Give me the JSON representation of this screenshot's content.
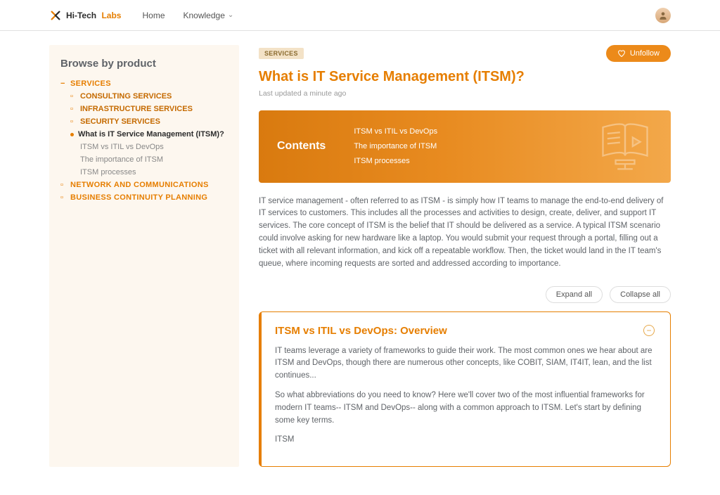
{
  "nav": {
    "brand_dark": "Hi-Tech",
    "brand_orange": "Labs",
    "home": "Home",
    "knowledge": "Knowledge"
  },
  "sidebar": {
    "heading": "Browse by product",
    "root": "SERVICES",
    "subs": {
      "consulting": "CONSULTING SERVICES",
      "infra": "INFRASTRUCTURE SERVICES",
      "security": "SECURITY SERVICES"
    },
    "selected": "What is IT Service Management (ITSM)?",
    "leaves": {
      "l1": "ITSM vs ITIL vs DevOps",
      "l2": "The importance of ITSM",
      "l3": "ITSM processes"
    },
    "cats": {
      "network": "NETWORK AND COMMUNICATIONS",
      "bcp": "BUSINESS CONTINUITY PLANNING"
    }
  },
  "article": {
    "badge": "SERVICES",
    "unfollow": "Unfollow",
    "title": "What is IT Service Management (ITSM)?",
    "meta": "Last updated a minute ago",
    "contents_label": "Contents",
    "contents": {
      "c1": "ITSM vs ITIL vs DevOps",
      "c2": "The importance of ITSM",
      "c3": "ITSM processes"
    },
    "intro": "IT service management - often referred to as ITSM - is simply how IT teams to manage the end-to-end delivery of IT services to customers. This includes all the processes and activities to design, create, deliver, and support IT services. The core concept of ITSM is the belief that IT should be delivered as a service. A typical ITSM scenario could involve asking for new hardware like a laptop. You would submit your request through a portal, filling out a ticket with all relevant information, and kick off a repeatable workflow. Then, the ticket would land in the IT team's queue, where incoming requests are sorted and addressed according to importance.",
    "expand": "Expand all",
    "collapse": "Collapse all"
  },
  "panel": {
    "title": "ITSM vs ITIL vs DevOps: Overview",
    "p1": "IT teams leverage a variety of frameworks to guide their work. The most common ones we hear about are ITSM and DevOps, though there are numerous other concepts, like COBIT, SIAM, IT4IT, lean, and the list continues...",
    "p2": "So what abbreviations do you need to know? Here we'll cover two of the most influential frameworks for modern IT teams-- ITSM and DevOps-- along with a common approach to ITSM. Let's start by defining some key terms.",
    "p3": "ITSM"
  }
}
